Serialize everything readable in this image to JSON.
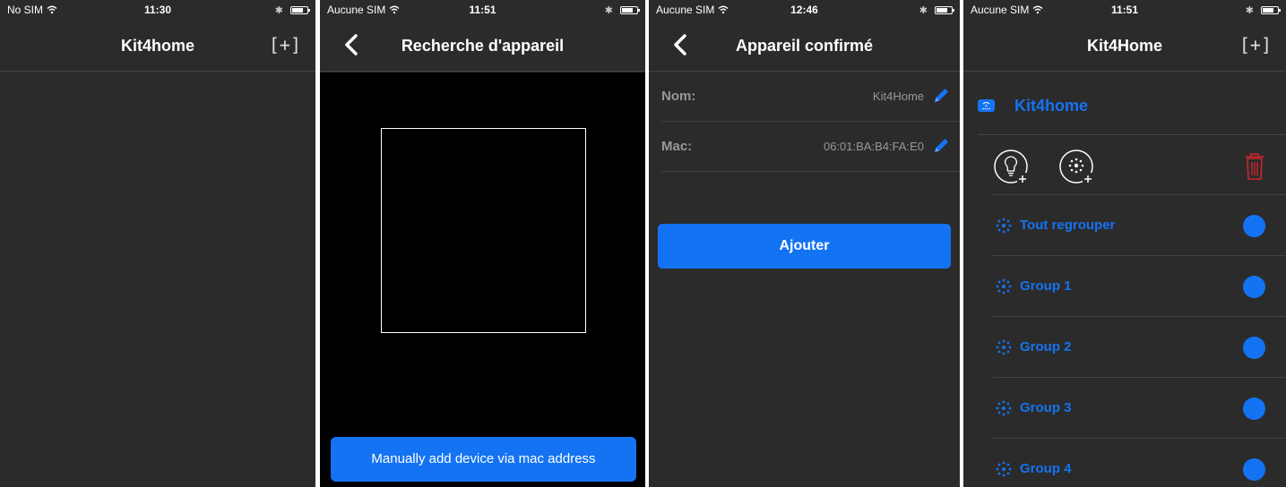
{
  "screens": [
    {
      "status": {
        "carrier": "No SIM",
        "time": "11:30"
      },
      "nav": {
        "title": "Kit4home",
        "add_label": "[+]"
      }
    },
    {
      "status": {
        "carrier": "Aucune SIM",
        "time": "11:51"
      },
      "nav": {
        "title": "Recherche d'appareil"
      },
      "manual_button": "Manually add device via mac address"
    },
    {
      "status": {
        "carrier": "Aucune SIM",
        "time": "12:46"
      },
      "nav": {
        "title": "Appareil confirmé"
      },
      "fields": [
        {
          "label": "Nom:",
          "value": "Kit4Home"
        },
        {
          "label": "Mac:",
          "value": "06:01:BA:B4:FA:E0"
        }
      ],
      "add_button": "Ajouter"
    },
    {
      "status": {
        "carrier": "Aucune SIM",
        "time": "11:51"
      },
      "nav": {
        "title": "Kit4Home",
        "add_label": "[+]"
      },
      "device": {
        "name": "Kit4home"
      },
      "groups": [
        {
          "name": "Tout regrouper"
        },
        {
          "name": "Group 1"
        },
        {
          "name": "Group 2"
        },
        {
          "name": "Group 3"
        },
        {
          "name": "Group 4"
        }
      ]
    }
  ],
  "colors": {
    "accent": "#1473f3",
    "background": "#2b2b2b",
    "delete": "#d0262b"
  }
}
